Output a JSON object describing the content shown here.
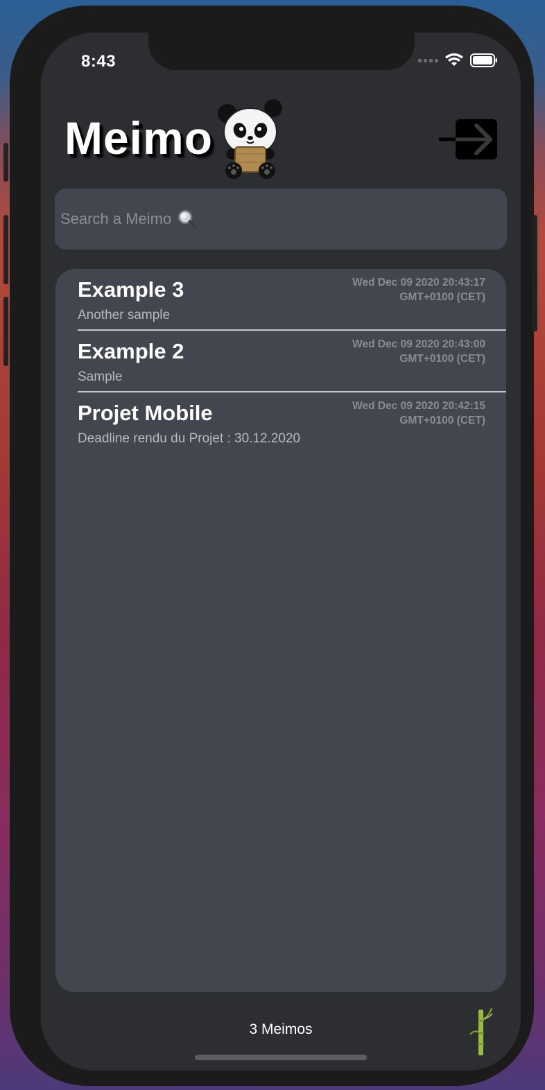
{
  "status_bar": {
    "time": "8:43"
  },
  "header": {
    "title": "Meimo",
    "logout_icon": "arrow-right-to-bracket-icon"
  },
  "search": {
    "placeholder": "Search a Meimo",
    "icon": "magnifying-glass-icon"
  },
  "memos": [
    {
      "title": "Example 3",
      "subtitle": "Another sample",
      "date_line1": "Wed Dec 09 2020 20:43:17",
      "date_line2": "GMT+0100 (CET)"
    },
    {
      "title": "Example 2",
      "subtitle": "Sample",
      "date_line1": "Wed Dec 09 2020 20:43:00",
      "date_line2": "GMT+0100 (CET)"
    },
    {
      "title": "Projet Mobile",
      "subtitle": "Deadline rendu du Projet : 30.12.2020",
      "date_line1": "Wed Dec 09 2020 20:42:15",
      "date_line2": "GMT+0100 (CET)"
    }
  ],
  "footer": {
    "count_label": "3 Meimos",
    "bamboo_icon": "bamboo-icon"
  },
  "colors": {
    "screen_bg": "#2d2e32",
    "card_bg": "#44464f",
    "text_primary": "#ffffff",
    "text_secondary": "#b8bac1",
    "date_text": "#8a8c95"
  }
}
